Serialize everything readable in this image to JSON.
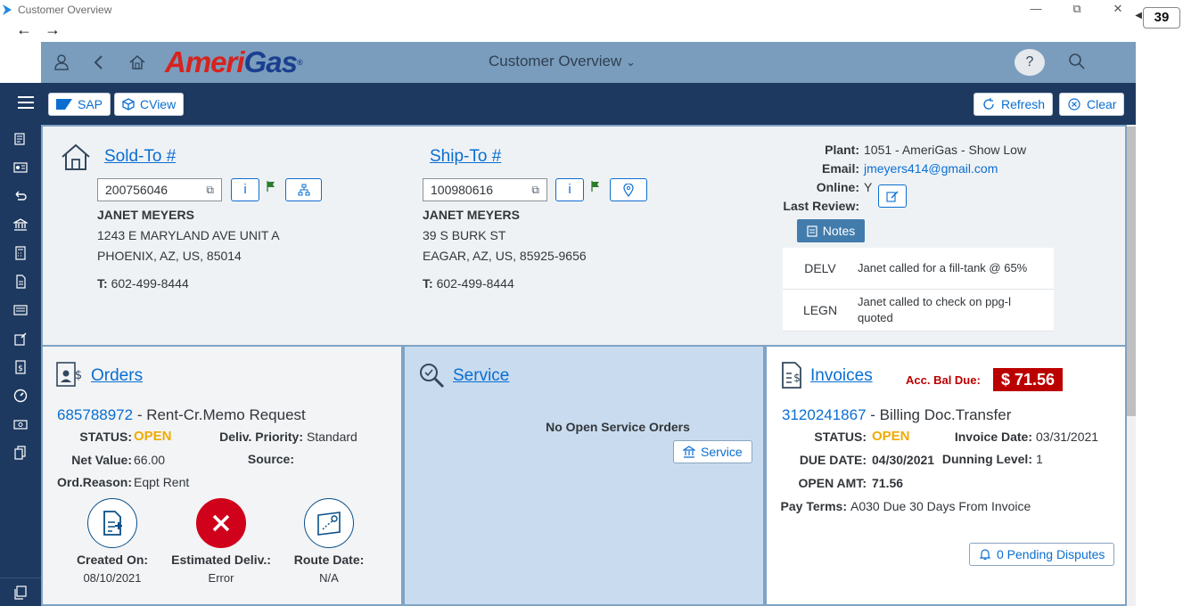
{
  "window": {
    "title": "Customer Overview",
    "tab_count": "39"
  },
  "shell": {
    "logo_part1": "Ameri",
    "logo_part2": "Gas",
    "title": "Customer Overview",
    "help_label": "?"
  },
  "toolbar": {
    "sap_label": "SAP",
    "cview_label": "CView",
    "refresh_label": "Refresh",
    "clear_label": "Clear"
  },
  "sold_to": {
    "title": "Sold-To #",
    "id": "200756046",
    "name": "JANET MEYERS",
    "address1": "1243 E MARYLAND AVE UNIT A",
    "address2": "PHOENIX, AZ, US, 85014",
    "phone_label": "T:",
    "phone": "602-499-8444"
  },
  "ship_to": {
    "title": "Ship-To #",
    "id": "100980616",
    "name": "JANET MEYERS",
    "address1": "39 S BURK ST",
    "address2": "EAGAR, AZ, US, 85925-9656",
    "phone_label": "T:",
    "phone": "602-499-8444"
  },
  "account": {
    "plant_label": "Plant:",
    "plant": "1051 - AmeriGas - Show Low",
    "email_label": "Email:",
    "email": "jmeyers414@gmail.com",
    "online_label": "Online:",
    "online": "Y",
    "last_review_label": "Last Review:",
    "notes_label": "Notes",
    "notes": [
      {
        "code": "DELV",
        "text": "Janet called for a fill-tank @ 65%"
      },
      {
        "code": "LEGN",
        "text": "Janet called to check on ppg-l quoted"
      }
    ]
  },
  "orders": {
    "title": "Orders",
    "order_number": "685788972",
    "order_type": " - Rent-Cr.Memo Request",
    "status_label": "STATUS:",
    "status": "OPEN",
    "deliv_priority_label": "Deliv. Priority:",
    "deliv_priority": "Standard",
    "net_value_label": "Net Value:",
    "net_value": "66.00",
    "source_label": "Source:",
    "ord_reason_label": "Ord.Reason:",
    "ord_reason": "Eqpt Rent",
    "created_label": "Created On:",
    "created": "08/10/2021",
    "est_deliv_label": "Estimated Deliv.:",
    "est_deliv": "Error",
    "route_label": "Route Date:",
    "route": "N/A"
  },
  "service": {
    "title": "Service",
    "empty_text": "No Open Service Orders",
    "button_label": "Service"
  },
  "invoices": {
    "title": "Invoices",
    "balance_label": "Acc. Bal Due:",
    "balance": "$ 71.56",
    "invoice_number": "3120241867",
    "invoice_type": " - Billing Doc.Transfer",
    "status_label": "STATUS:",
    "status": "OPEN",
    "invoice_date_label": "Invoice Date:",
    "invoice_date": "03/31/2021",
    "due_date_label": "DUE DATE:",
    "due_date": "04/30/2021",
    "dunning_label": "Dunning Level:",
    "dunning": "1",
    "open_amt_label": "OPEN AMT:",
    "open_amt": "71.56",
    "pay_terms_label": "Pay Terms:",
    "pay_terms": "A030 Due 30 Days From Invoice",
    "disputes_label": "0 Pending Disputes"
  },
  "colors": {
    "brand_red": "#d6231e",
    "brand_blue": "#1b3f8f",
    "link": "#0a6ed1",
    "status_open": "#f0ab00",
    "balance_bg": "#bb0000",
    "nav_bg": "#1d3960"
  }
}
